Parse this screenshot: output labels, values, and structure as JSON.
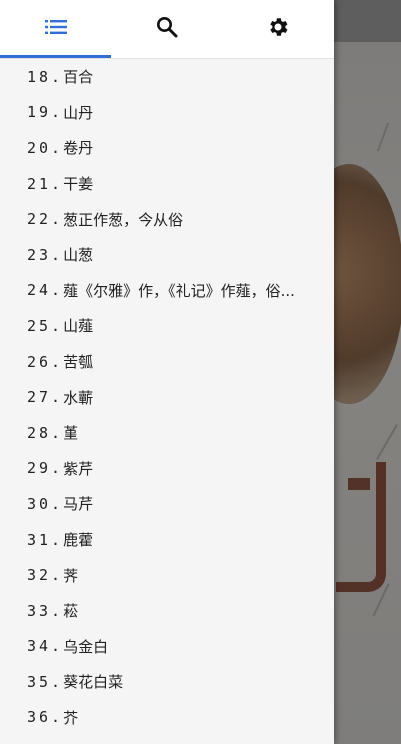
{
  "drawer": {
    "tabs": [
      {
        "name": "tab-contents",
        "icon": "list-icon",
        "active": true
      },
      {
        "name": "tab-search",
        "icon": "search-icon",
        "active": false
      },
      {
        "name": "tab-settings",
        "icon": "gear-icon",
        "active": false
      }
    ],
    "accent_color": "#2f6fd6",
    "items": [
      {
        "number": "18.",
        "title": "百合"
      },
      {
        "number": "19.",
        "title": "山丹"
      },
      {
        "number": "20.",
        "title": "卷丹"
      },
      {
        "number": "21.",
        "title": "干姜"
      },
      {
        "number": "22.",
        "title": "葱正作葱，今从俗"
      },
      {
        "number": "23.",
        "title": "山葱"
      },
      {
        "number": "24.",
        "title": "薤《尔雅》作，《礼记》作薤，俗..."
      },
      {
        "number": "25.",
        "title": "山薤"
      },
      {
        "number": "26.",
        "title": "苦瓠"
      },
      {
        "number": "27.",
        "title": "水蘄"
      },
      {
        "number": "28.",
        "title": "堇"
      },
      {
        "number": "29.",
        "title": "紫芹"
      },
      {
        "number": "30.",
        "title": "马芹"
      },
      {
        "number": "31.",
        "title": "鹿藿"
      },
      {
        "number": "32.",
        "title": "荠"
      },
      {
        "number": "33.",
        "title": "菘"
      },
      {
        "number": "34.",
        "title": "乌金白"
      },
      {
        "number": "35.",
        "title": "葵花白菜"
      },
      {
        "number": "36.",
        "title": "芥"
      }
    ]
  }
}
